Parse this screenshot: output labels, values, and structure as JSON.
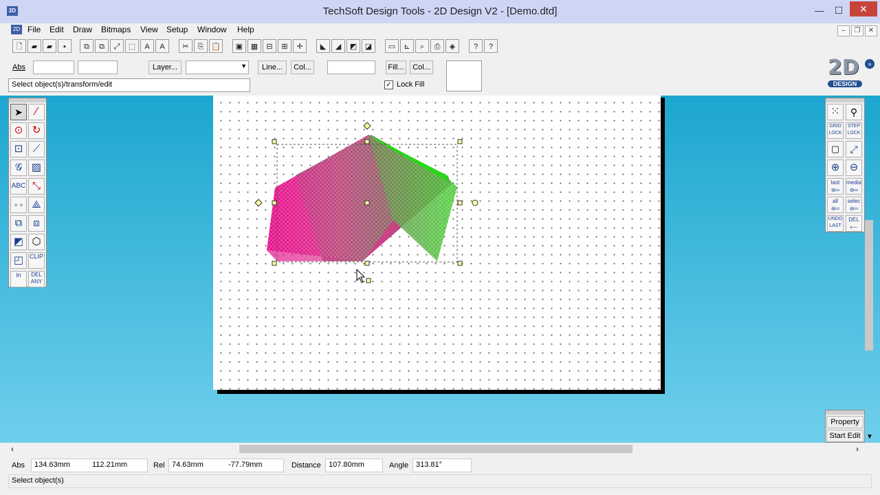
{
  "window": {
    "title": "TechSoft Design Tools - 2D Design V2 - [Demo.dtd]",
    "app_icon_text": "2D",
    "minimize_glyph": "—",
    "maximize_glyph": "☐",
    "close_glyph": "✕",
    "mdi_minimize_glyph": "–",
    "mdi_restore_glyph": "❐",
    "mdi_close_glyph": "✕"
  },
  "menu": [
    "File",
    "Edit",
    "Draw",
    "Bitmaps",
    "View",
    "Setup",
    "Window",
    "Help"
  ],
  "properties": {
    "abs_label": "Abs",
    "layer_button": "Layer...",
    "line_button": "Line...",
    "line_col_button": "Col...",
    "fill_button": "Fill...",
    "fill_col_button": "Col...",
    "lock_fill_label": "Lock Fill",
    "lock_fill_checked": true,
    "prompt": "Select object(s)/transform/edit"
  },
  "logo": {
    "main": "2D",
    "sub": "DESIGN"
  },
  "left_tools": [
    "select",
    "line",
    "circle",
    "arc",
    "rectangle",
    "polyline",
    "spiral",
    "hatch",
    "ABC",
    "dimension",
    "points",
    "construct",
    "group",
    "array",
    "fill",
    "3d",
    "edit",
    "CLIP",
    "in",
    "DEL ANY"
  ],
  "right_tools": {
    "grid_lock": "GRID LOCK",
    "step_lock": "STEP LOCK",
    "last": "last",
    "media": "media",
    "all": "all",
    "selec": "selec",
    "undo_last": "UNDO LAST",
    "del": "DEL"
  },
  "property_panel": {
    "property": "Property",
    "start_edit": "Start Edit"
  },
  "status": {
    "abs_label": "Abs",
    "abs_x": "134.63mm",
    "abs_y": "112.21mm",
    "rel_label": "Rel",
    "rel_x": "74.63mm",
    "rel_y": "-77.79mm",
    "distance_label": "Distance",
    "distance": "107.80mm",
    "angle_label": "Angle",
    "angle": "313.81°",
    "message": "Select object(s)"
  },
  "colors": {
    "workspace_top": "#1ca6cf",
    "shape_magenta": "#e8108f",
    "shape_green": "#3fcc2a"
  }
}
